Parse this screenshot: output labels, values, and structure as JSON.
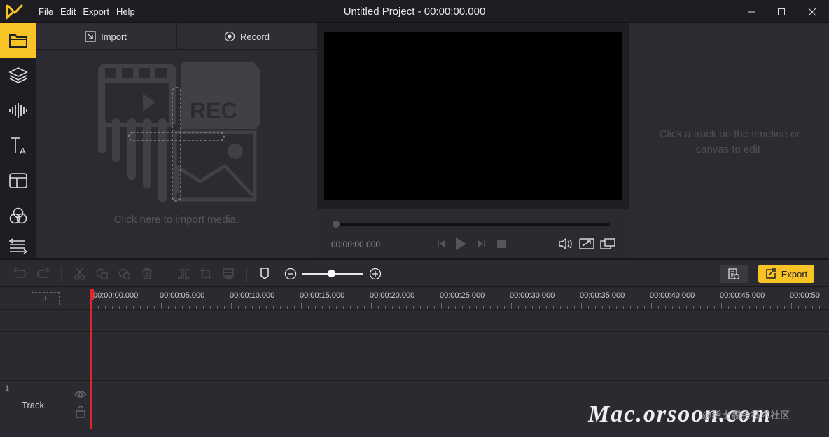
{
  "app": {
    "title": "Untitled Project - 00:00:00.000",
    "menu": [
      "File",
      "Edit",
      "Export",
      "Help"
    ],
    "accent": "#f7c325"
  },
  "sidebar": {
    "items": [
      {
        "name": "media",
        "icon": "folder-icon",
        "active": true
      },
      {
        "name": "layers",
        "icon": "layers-icon"
      },
      {
        "name": "audio",
        "icon": "waveform-icon"
      },
      {
        "name": "text",
        "icon": "text-icon"
      },
      {
        "name": "templates",
        "icon": "template-icon"
      },
      {
        "name": "filters",
        "icon": "filter-circles-icon"
      },
      {
        "name": "transitions",
        "icon": "transition-icon"
      }
    ]
  },
  "media": {
    "import_label": "Import",
    "record_label": "Record",
    "placeholder_rec": "REC",
    "hint": "Click here to import media."
  },
  "preview": {
    "timecode": "00:00:00.000"
  },
  "properties": {
    "hint": "Click a track on the timeline or canvas to edit."
  },
  "toolbar": {
    "export_label": "Export"
  },
  "timeline": {
    "add_track": "+",
    "ticks": [
      "00:00:00.000",
      "00:00:05.000",
      "00:00:10.000",
      "00:00:15.000",
      "00:00:20.000",
      "00:00:25.000",
      "00:00:30.000",
      "00:00:35.000",
      "00:00:40.000",
      "00:00:45.000",
      "00:00:50"
    ],
    "track": {
      "number": "1",
      "name": "Track"
    }
  },
  "watermark": {
    "text": "Mac.orsoon.com",
    "sub": "@稀土掘金技术社区"
  }
}
